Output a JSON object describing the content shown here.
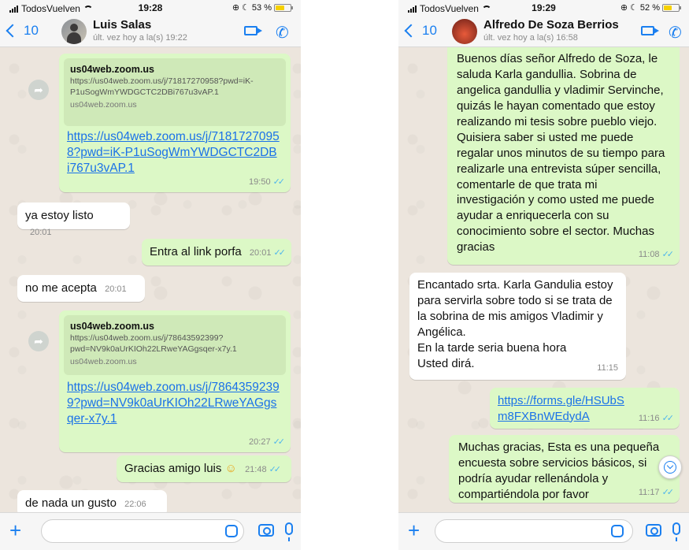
{
  "left": {
    "status": {
      "carrier": "TodosVuelven",
      "time": "19:28",
      "battery": "53 %",
      "battery_level": 0.53
    },
    "header": {
      "back_count": "10",
      "name": "Luis Salas",
      "last_seen": "últ. vez hoy a la(s) 19:22"
    },
    "messages": {
      "m1": {
        "preview_title": "us04web.zoom.us",
        "preview_url": "https://us04web.zoom.us/j/71817270958?pwd=iK-P1uSogWmYWDGCTC2DBi767u3vAP.1",
        "preview_domain": "us04web.zoom.us",
        "link": "https://us04web.zoom.us/j/71817270958?pwd=iK-P1uSogWmYWDGCTC2DBi767u3vAP.1",
        "time": "19:50"
      },
      "m2": {
        "text": "ya estoy listo",
        "time": "20:01"
      },
      "m3": {
        "text": "Entra al link porfa",
        "time": "20:01"
      },
      "m4": {
        "text": "no me acepta",
        "time": "20:01"
      },
      "m5": {
        "preview_title": "us04web.zoom.us",
        "preview_url": "https://us04web.zoom.us/j/78643592399?pwd=NV9k0aUrKIOh22LRweYAGgsqer-x7y.1",
        "preview_domain": "us04web.zoom.us",
        "link": "https://us04web.zoom.us/j/78643592399?pwd=NV9k0aUrKIOh22LRweYAGgsqer-x7y.1",
        "time": "20:27"
      },
      "m6": {
        "text": "Gracias amigo luis",
        "emoji": "☺",
        "time": "21:48"
      },
      "m7": {
        "text": "de nada un gusto",
        "time": "22:06"
      }
    }
  },
  "right": {
    "status": {
      "carrier": "TodosVuelven",
      "time": "19:29",
      "battery": "52 %",
      "battery_level": 0.52
    },
    "header": {
      "back_count": "10",
      "name": "Alfredo De Soza Berrios",
      "last_seen": "últ. vez hoy a la(s) 16:58"
    },
    "messages": {
      "m1": {
        "text": "Buenos días señor Alfredo de Soza, le saluda Karla gandullia. Sobrina de angelica gandullia y vladimir Servinche, quizás le hayan comentado que estoy realizando mi tesis sobre pueblo viejo. Quisiera saber si usted me puede regalar unos minutos de su tiempo para realizarle una entrevista súper sencilla, comentarle de que trata mi investigación y como usted me puede ayudar a enriquecerla con su conocimiento sobre el sector. Muchas gracias",
        "time": "11:08"
      },
      "m2": {
        "text": "Encantado srta. Karla Gandulia estoy para servirla sobre todo si se trata de la sobrina de mis amigos Vladimir y Angélica.\nEn la tarde seria buena hora\nUsted dirá.",
        "time": "11:15"
      },
      "m3": {
        "link": "https://forms.gle/HSUbSm8FXBnWEdydA",
        "time": "11:16"
      },
      "m4": {
        "text": "Muchas gracias, Esta es una pequeña encuesta sobre servicios básicos, si podría ayudar rellenándola y compartiéndola por favor",
        "time": "11:17"
      }
    }
  }
}
